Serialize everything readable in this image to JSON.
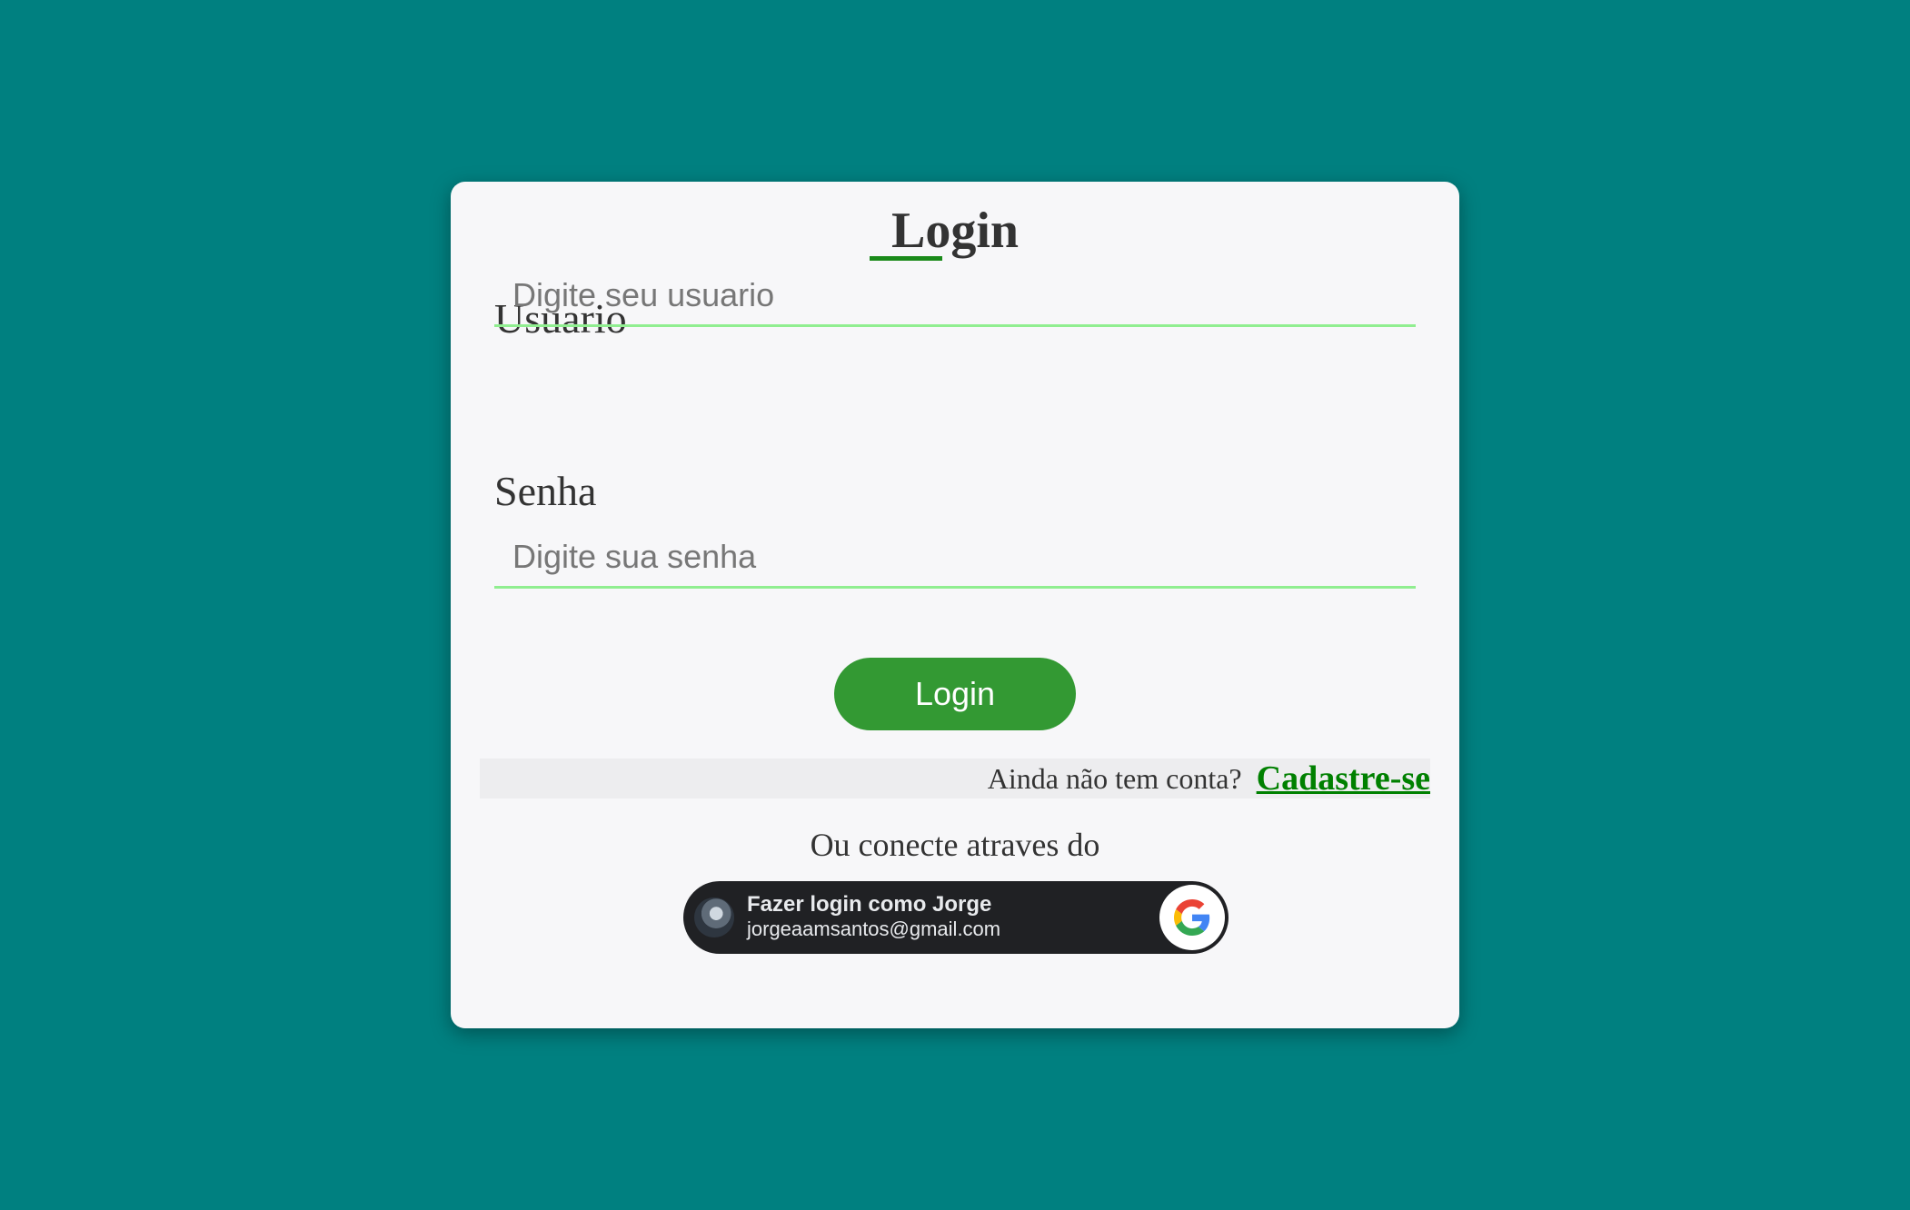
{
  "page": {
    "background_color": "#008080"
  },
  "form": {
    "title": "Login",
    "username_label": "Usuario",
    "username_placeholder": "Digite seu usuario",
    "password_label": "Senha",
    "password_placeholder": "Digite sua senha",
    "submit_label": "Login",
    "accent_color": "#339933"
  },
  "signup": {
    "prompt": "Ainda não tem conta?",
    "link_label": "Cadastre-se",
    "link_color": "#008000"
  },
  "social": {
    "or_text": "Ou conecte atraves do",
    "google_button": {
      "title": "Fazer login como Jorge",
      "email": "jorgeaamsantos@gmail.com",
      "icon": "google-g-icon"
    }
  }
}
